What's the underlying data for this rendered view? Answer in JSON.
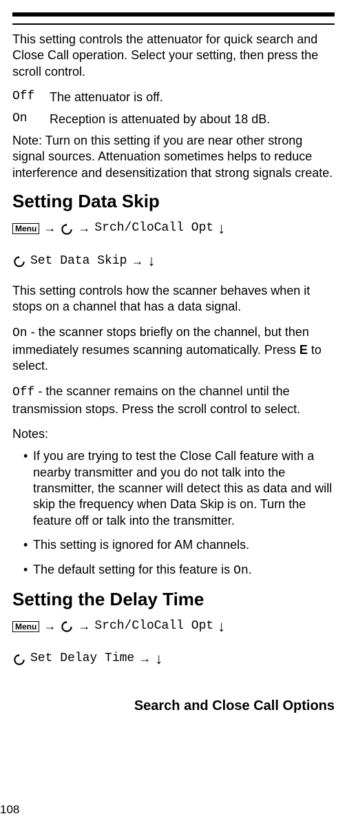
{
  "intro": "This setting controls the attenuator for quick search and Close Call operation. Select your setting, then press the scroll control.",
  "off": {
    "label": "Off",
    "desc": "The attenuator is off."
  },
  "on": {
    "label": "On",
    "desc": "Reception is attenuated by about 18 dB."
  },
  "note_attenuator": "Note: Turn on this setting if you are near other strong signal sources. Attenuation sometimes helps to reduce interference and desensitization that strong signals create.",
  "heading_data_skip": "Setting Data Skip",
  "menu_label": "Menu",
  "nav": {
    "srch_opt": "Srch/CloCall Opt",
    "set_data_skip": "Set Data Skip",
    "set_delay_time": "Set Delay Time"
  },
  "data_skip_intro": "This setting controls how the scanner behaves when it stops on a channel that has a data signal.",
  "data_skip_on": {
    "label": "On",
    "desc": " - the scanner stops briefly on the channel, but then immediately resumes scanning automatically. Press ",
    "key": "E",
    "desc2": " to select."
  },
  "data_skip_off": {
    "label": "Off",
    "desc": " - the scanner remains on the channel until the transmission stops. Press the scroll control to select."
  },
  "notes_label": "Notes:",
  "notes": [
    "If you are trying to test the Close Call feature with a nearby transmitter and you do not talk into the transmitter, the scanner will detect this as data and will skip the frequency when Data Skip is on. Turn the feature off or talk into the transmitter.",
    "This setting is ignored for AM channels."
  ],
  "note_default_prefix": "The default setting for this feature is ",
  "note_default_value": "On",
  "note_default_suffix": ".",
  "heading_delay_time": "Setting the Delay Time",
  "footer_title": "Search and Close Call Options",
  "page_number": "108"
}
